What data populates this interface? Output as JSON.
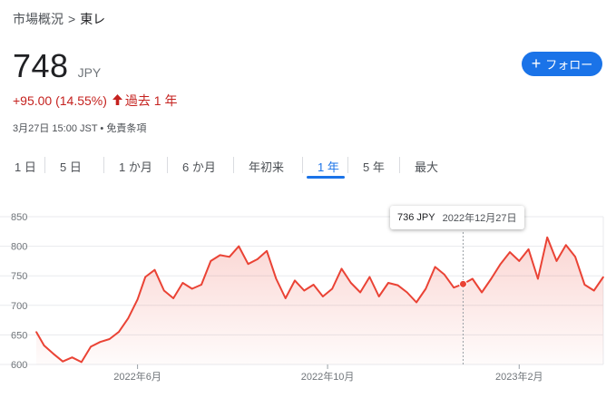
{
  "breadcrumb": {
    "parent": "市場概況",
    "separator": ">",
    "current": "東レ"
  },
  "quote": {
    "price": "748",
    "currency": "JPY",
    "change": "+95.00 (14.55%)",
    "change_arrow": "🡑",
    "period": "過去 1 年",
    "timestamp": "3月27日 15:00 JST • 免責条項"
  },
  "follow_button": {
    "icon": "plus-icon",
    "label": "フォロー"
  },
  "range_tabs": [
    {
      "label": "1 日",
      "selected": false
    },
    {
      "label": "5 日",
      "selected": false
    },
    {
      "label": "1 か月",
      "selected": false
    },
    {
      "label": "6 か月",
      "selected": false
    },
    {
      "label": "年初来",
      "selected": false
    },
    {
      "label": "1 年",
      "selected": true
    },
    {
      "label": "5 年",
      "selected": false
    },
    {
      "label": "最大",
      "selected": false
    }
  ],
  "tooltip": {
    "value": "736 JPY",
    "date": "2022年12月27日"
  },
  "colors": {
    "accent": "#1a73e8",
    "negative_line": "#ea4335",
    "change_text": "#c5221f"
  },
  "chart_data": {
    "type": "area",
    "title": "",
    "xlabel": "",
    "ylabel": "",
    "ylim": [
      600,
      850
    ],
    "yticks": [
      600,
      650,
      700,
      750,
      800,
      850
    ],
    "xlim": [
      "2022-03-28",
      "2023-03-27"
    ],
    "xticks": [
      {
        "date": "2022-06-01",
        "label": "2022年6月"
      },
      {
        "date": "2022-10-01",
        "label": "2022年10月"
      },
      {
        "date": "2023-02-01",
        "label": "2023年2月"
      }
    ],
    "grid": true,
    "highlight": {
      "date": "2022-12-27",
      "value": 736
    },
    "series": [
      {
        "x": [
          "2022-03-28",
          "2022-04-02",
          "2022-04-08",
          "2022-04-14",
          "2022-04-20",
          "2022-04-26",
          "2022-05-02",
          "2022-05-08",
          "2022-05-14",
          "2022-05-20",
          "2022-05-26",
          "2022-06-01",
          "2022-06-06",
          "2022-06-12",
          "2022-06-18",
          "2022-06-24",
          "2022-06-30",
          "2022-07-06",
          "2022-07-12",
          "2022-07-18",
          "2022-07-24",
          "2022-07-30",
          "2022-08-05",
          "2022-08-11",
          "2022-08-17",
          "2022-08-23",
          "2022-08-29",
          "2022-09-04",
          "2022-09-10",
          "2022-09-16",
          "2022-09-22",
          "2022-09-28",
          "2022-10-04",
          "2022-10-10",
          "2022-10-16",
          "2022-10-22",
          "2022-10-28",
          "2022-11-03",
          "2022-11-09",
          "2022-11-15",
          "2022-11-21",
          "2022-11-27",
          "2022-12-03",
          "2022-12-09",
          "2022-12-15",
          "2022-12-21",
          "2022-12-27",
          "2023-01-02",
          "2023-01-08",
          "2023-01-14",
          "2023-01-20",
          "2023-01-26",
          "2023-02-01",
          "2023-02-07",
          "2023-02-13",
          "2023-02-19",
          "2023-02-25",
          "2023-03-03",
          "2023-03-09",
          "2023-03-15",
          "2023-03-21",
          "2023-03-27"
        ],
        "values": [
          655,
          632,
          618,
          605,
          612,
          604,
          630,
          638,
          643,
          655,
          678,
          710,
          748,
          760,
          725,
          712,
          738,
          728,
          735,
          775,
          785,
          782,
          800,
          770,
          778,
          792,
          745,
          712,
          742,
          725,
          735,
          715,
          728,
          762,
          738,
          722,
          748,
          715,
          738,
          734,
          722,
          705,
          728,
          765,
          752,
          730,
          736,
          745,
          722,
          745,
          770,
          790,
          775,
          795,
          745,
          815,
          775,
          802,
          782,
          735,
          725,
          748
        ]
      }
    ]
  }
}
